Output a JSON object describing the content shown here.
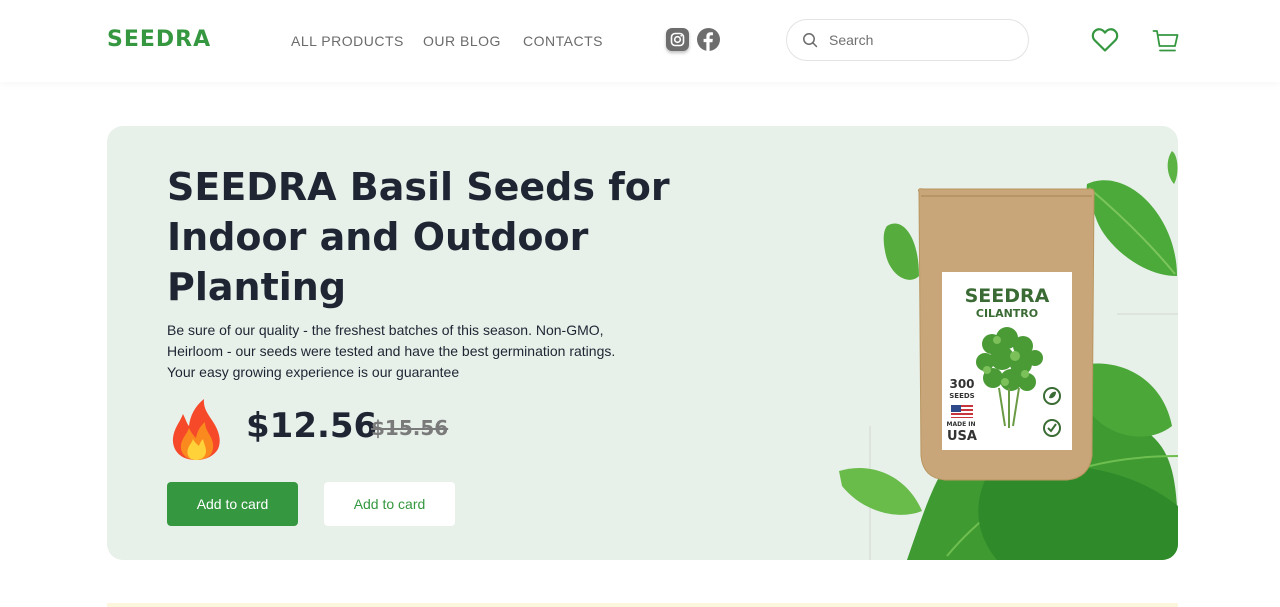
{
  "header": {
    "logo": "SEEDRA",
    "nav": [
      {
        "label": "ALL PRODUCTS"
      },
      {
        "label": "OUR BLOG"
      },
      {
        "label": "CONTACTS"
      }
    ],
    "social": [
      "instagram-icon",
      "facebook-icon"
    ],
    "search": {
      "placeholder": "Search",
      "value": ""
    },
    "icons": [
      "heart-icon",
      "cart-icon"
    ]
  },
  "hero": {
    "title": "SEEDRA Basil Seeds for Indoor and Outdoor Planting",
    "description": "Be sure of our quality - the freshest batches of this season. Non-GMO, Heirloom - our seeds were tested and have the best germination ratings. Your easy growing experience is our guarantee",
    "price": "$12.56",
    "old_price": "$15.56",
    "buttons": {
      "primary": "Add to card",
      "secondary": "Add to card"
    },
    "product_image": {
      "brand": "SEEDRA",
      "variety": "CILANTRO",
      "seeds_count": "300",
      "seeds_label": "SEEDS",
      "made_in": "MADE IN",
      "country": "USA"
    }
  },
  "colors": {
    "brand_green": "#359740",
    "hero_bg": "#e8f0ea",
    "text_dark": "#1f2532",
    "nav_gray": "#6b6b6b"
  }
}
